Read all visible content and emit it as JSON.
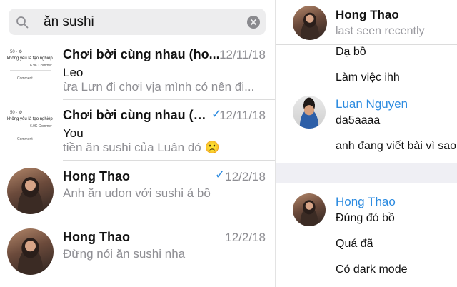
{
  "search": {
    "query": "ăn sushi"
  },
  "results": [
    {
      "title": "Chơi bời cùng nhau (ho...",
      "date": "12/11/18",
      "read": false,
      "sender": "Leo",
      "preview": "ừa Lưn đi chơi vịa mình có nên đi...",
      "thumb": {
        "line1": "50 · ⚙",
        "line2": "không yêu là tạo nghiệp",
        "line3": "6.9K Commer",
        "line4": "Comment"
      }
    },
    {
      "title": "Chơi bời cùng nhau (h...",
      "date": "12/11/18",
      "read": true,
      "sender": "You",
      "preview": "tiền ăn sushi của Luân đó 🙁",
      "thumb": {
        "line1": "50 · ⚙",
        "line2": "không yêu là tạo nghiệp",
        "line3": "6.9K Commer",
        "line4": "Comment"
      }
    },
    {
      "title": "Hong Thao",
      "date": "12/2/18",
      "read": true,
      "preview": "Anh ăn udon với sushi á bồ"
    },
    {
      "title": "Hong Thao",
      "date": "12/2/18",
      "read": false,
      "preview": "Đừng nói ăn sushi nha"
    }
  ],
  "chat": {
    "contact": "Hong Thao",
    "status": "last seen recently",
    "messages_top": [
      "Dạ bồ",
      "Làm việc ihh"
    ],
    "group1": {
      "author": "Luan Nguyen",
      "lines": [
        "da5aaaa",
        "anh đang viết bài vì sao"
      ]
    },
    "group2": {
      "author": "Hong Thao",
      "lines": [
        "Đúng đó bồ",
        "Quá đã",
        "Có dark mode"
      ]
    },
    "colors": {
      "accent": "#2c8be0",
      "muted": "#8e8e93"
    }
  },
  "icons": {
    "search": "search-icon",
    "clear": "clear-icon",
    "check": "check-icon"
  }
}
